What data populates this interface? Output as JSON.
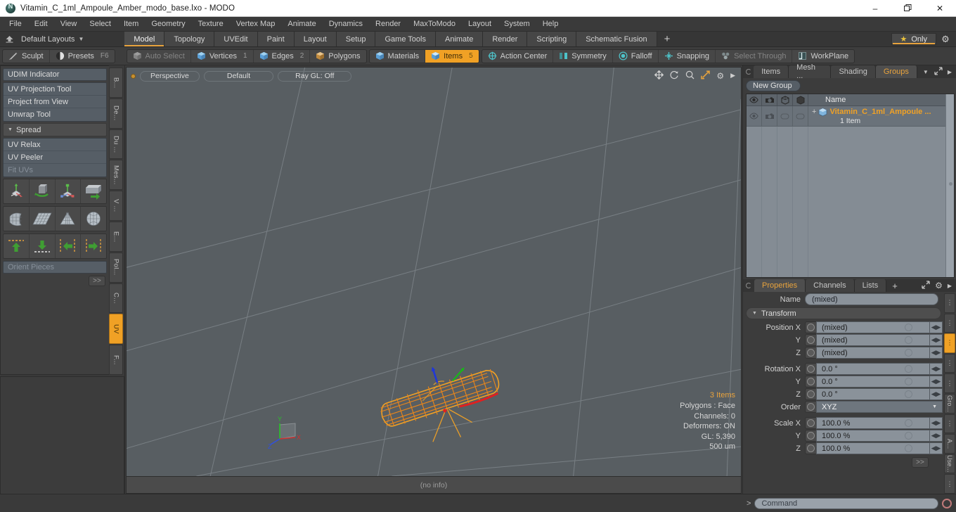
{
  "window": {
    "title": "Vitamin_C_1ml_Ampoule_Amber_modo_base.lxo - MODO",
    "logo_icon": "modo-logo-icon",
    "minimize": "–",
    "maximize": "❐",
    "close": "✕"
  },
  "menubar": {
    "items": [
      "File",
      "Edit",
      "View",
      "Select",
      "Item",
      "Geometry",
      "Texture",
      "Vertex Map",
      "Animate",
      "Dynamics",
      "Render",
      "MaxToModo",
      "Layout",
      "System",
      "Help"
    ]
  },
  "layoutbar": {
    "home_icon": "home-icon",
    "layout_selector": "Default Layouts",
    "caret": "▼",
    "tabs": [
      "Model",
      "Topology",
      "UVEdit",
      "Paint",
      "Layout",
      "Setup",
      "Game Tools",
      "Animate",
      "Render",
      "Scripting",
      "Schematic Fusion"
    ],
    "active_tab": "Model",
    "add_tab": "+",
    "only_label": "Only",
    "star_icon": "star-icon",
    "gear_icon": "gear-icon"
  },
  "toolbar": {
    "sculpt": "Sculpt",
    "presets": "Presets",
    "presets_key": "F6",
    "selection_modes": [
      {
        "label": "Auto Select",
        "count": "",
        "state": "dim"
      },
      {
        "label": "Vertices",
        "count": "1",
        "state": "normal"
      },
      {
        "label": "Edges",
        "count": "2",
        "state": "normal"
      },
      {
        "label": "Polygons",
        "count": "",
        "state": "normal"
      }
    ],
    "items_modes": [
      {
        "label": "Materials",
        "count": "",
        "state": "normal"
      },
      {
        "label": "Items",
        "count": "5",
        "state": "selected"
      }
    ],
    "right_tools": [
      {
        "label": "Action Center",
        "icon": "action-center-icon",
        "state": "normal"
      },
      {
        "label": "Symmetry",
        "icon": "symmetry-icon",
        "state": "normal"
      },
      {
        "label": "Falloff",
        "icon": "falloff-icon",
        "state": "normal"
      },
      {
        "label": "Snapping",
        "icon": "snapping-icon",
        "state": "normal"
      },
      {
        "label": "Select Through",
        "icon": "select-through-icon",
        "state": "dim"
      },
      {
        "label": "WorkPlane",
        "icon": "workplane-icon",
        "state": "normal"
      }
    ]
  },
  "left_panel": {
    "rows": [
      {
        "label": "UDIM Indicator",
        "type": "button",
        "state": "normal"
      },
      {
        "label": "UV Projection Tool",
        "type": "group-item",
        "state": "normal"
      },
      {
        "label": "Project from View",
        "type": "group-item",
        "state": "normal"
      },
      {
        "label": "Unwrap Tool",
        "type": "group-item",
        "state": "normal"
      },
      {
        "label": "Spread",
        "type": "section",
        "state": "normal"
      },
      {
        "label": "UV Relax",
        "type": "group-item",
        "state": "normal"
      },
      {
        "label": "UV Peeler",
        "type": "group-item",
        "state": "normal"
      },
      {
        "label": "Fit UVs",
        "type": "group-item",
        "state": "dim"
      }
    ],
    "icon_rows": [
      [
        "move-tool-icon",
        "rotate-tool-icon",
        "scale-tool-icon",
        "flip-tool-icon"
      ],
      [
        "uv-fit-icon",
        "uv-grid-icon",
        "uv-cone-icon",
        "uv-sphere-icon"
      ],
      [
        "align-up-icon",
        "align-down-icon",
        "align-left-icon",
        "align-right-icon"
      ]
    ],
    "orient_pieces": "Orient Pieces",
    "more": ">>",
    "vtabs": [
      "B...",
      "De...",
      "Du ...",
      "Mes...",
      "V ...",
      "E...",
      "Pol...",
      "C...",
      "UV",
      "F..."
    ],
    "vtab_active": "UV"
  },
  "viewport": {
    "dot_icon": "viewport-active-dot-icon",
    "pills": [
      "Perspective",
      "Default",
      "Ray GL: Off"
    ],
    "icons": [
      "move-view-icon",
      "rotate-view-icon",
      "zoom-view-icon",
      "fullscreen-icon",
      "gear-icon",
      "arrow-right-icon"
    ],
    "stats": {
      "items": "3 Items",
      "polygons": "Polygons : Face",
      "channels": "Channels: 0",
      "deformers": "Deformers: ON",
      "gl": "GL: 5,390",
      "scale": "500 um"
    },
    "axis": {
      "x": "X",
      "y": "Y",
      "z": "Z"
    },
    "footer": "(no info)"
  },
  "right_panel": {
    "top_tabs": [
      "Items",
      "Mesh ...",
      "Shading",
      "Groups"
    ],
    "top_active_tab": "Groups",
    "top_caret": "▼",
    "expand_icon": "expand-icon",
    "arrow_icon": "arrow-right-icon",
    "new_group_btn": "New Group",
    "list_columns": [
      "visibility-eye-icon",
      "render-camera-icon",
      "wireframe-icon",
      "shaded-icon"
    ],
    "name_column": "Name",
    "rows": [
      {
        "plus": "+",
        "icon": "group-item-icon",
        "name": "Vitamin_C_1ml_Ampoule ...",
        "subtext": "1 Item"
      }
    ],
    "bottom_tabs": [
      "Properties",
      "Channels",
      "Lists"
    ],
    "bottom_active_tab": "Properties",
    "add_tab": "+",
    "gear_icon": "gear-icon",
    "name_label": "Name",
    "name_value": "(mixed)",
    "transform_label": "Transform",
    "properties": [
      {
        "label": "Position X",
        "value": "(mixed)",
        "type": "field"
      },
      {
        "label": "Y",
        "value": "(mixed)",
        "type": "field"
      },
      {
        "label": "Z",
        "value": "(mixed)",
        "type": "field"
      },
      {
        "label": "Rotation X",
        "value": "0.0 °",
        "type": "field"
      },
      {
        "label": "Y",
        "value": "0.0 °",
        "type": "field"
      },
      {
        "label": "Z",
        "value": "0.0 °",
        "type": "field"
      },
      {
        "label": "Order",
        "value": "XYZ",
        "type": "dropdown"
      },
      {
        "label": "Scale X",
        "value": "100.0 %",
        "type": "field"
      },
      {
        "label": "Y",
        "value": "100.0 %",
        "type": "field"
      },
      {
        "label": "Z",
        "value": "100.0 %",
        "type": "field"
      }
    ],
    "more_btn": ">>",
    "vtabs": [
      "⋮",
      "⋮",
      "⋮",
      "⋮",
      "⋮",
      "Gro...",
      "⋮",
      "A...",
      "Use...",
      "⋮"
    ],
    "vtab_active_index": 2
  },
  "command_bar": {
    "prompt": ">",
    "placeholder": "Command",
    "record_icon": "record-icon"
  },
  "colors": {
    "accent_orange": "#f0a125",
    "panel_bg": "#3c3c3c",
    "viewport_bg": "#585e62",
    "field_bg": "#8a929a",
    "teal_icon": "#4ec3c9"
  }
}
